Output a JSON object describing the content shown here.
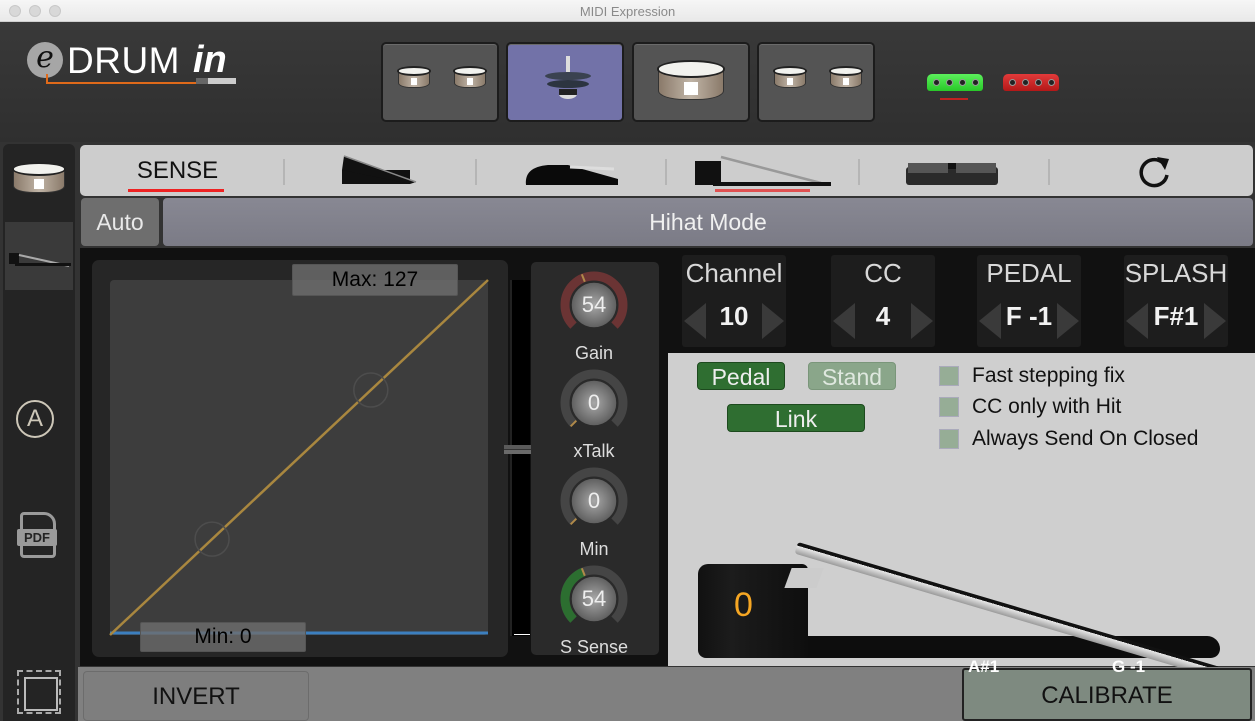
{
  "window": {
    "title": "MIDI Expression"
  },
  "logo": {
    "e": "e",
    "drum": "DRUM",
    "in": "in"
  },
  "header": {
    "pads": [
      {
        "name": "toms-left",
        "icon": "double-drum-icon",
        "active": false
      },
      {
        "name": "hihat",
        "icon": "hihat-cymbal-icon",
        "active": true
      },
      {
        "name": "snare",
        "icon": "snare-drum-icon",
        "active": false
      },
      {
        "name": "toms-right",
        "icon": "double-drum-icon",
        "active": false
      }
    ],
    "connectors": [
      {
        "name": "green-connector",
        "color": "#3ad43a",
        "selected": true
      },
      {
        "name": "red-connector",
        "color": "#cc2222",
        "selected": false
      }
    ]
  },
  "sidebar": {
    "items": [
      {
        "name": "drum-pad",
        "icon": "drum-icon"
      },
      {
        "name": "hihat-pedal",
        "icon": "hihat-pedal-icon",
        "selected": true
      },
      {
        "name": "auto",
        "icon": "circle-a-icon",
        "label": "A"
      },
      {
        "name": "pdf",
        "icon": "pdf-icon",
        "label": "PDF"
      },
      {
        "name": "hardware",
        "icon": "chip-icon"
      }
    ]
  },
  "tabs": {
    "sense_label": "SENSE",
    "items": [
      {
        "name": "sense",
        "selected": true
      },
      {
        "name": "expression-pedal",
        "icon": "expression-pedal-icon"
      },
      {
        "name": "sustain-pedal",
        "icon": "sustain-pedal-icon"
      },
      {
        "name": "hihat-pedal",
        "icon": "hihat-pedal-icon",
        "selected": true
      },
      {
        "name": "footswitch",
        "icon": "footswitch-icon"
      },
      {
        "name": "reset",
        "icon": "refresh-icon"
      }
    ],
    "accent": "#e02424"
  },
  "mode": {
    "auto_label": "Auto",
    "mode_label": "Hihat Mode"
  },
  "curve": {
    "max_label": "Max: 127",
    "min_label": "Min: 0",
    "max": 127,
    "min": 0,
    "control_points": [
      [
        0.27,
        0.27
      ],
      [
        0.69,
        0.69
      ]
    ],
    "level": 0,
    "curve_color": "#a9873f",
    "level_color": "#3c7fbf"
  },
  "knobs": [
    {
      "label": "Gain",
      "value": 54,
      "fraction": 0.42,
      "arc_color": "#6b3434",
      "active_color": "#6b3434"
    },
    {
      "label": "xTalk",
      "value": 0,
      "fraction": 0.0,
      "arc_color": "#454545",
      "active_color": "#454545"
    },
    {
      "label": "Min",
      "value": 0,
      "fraction": 0.0,
      "arc_color": "#454545",
      "active_color": "#454545"
    },
    {
      "label": "S Sense",
      "value": 54,
      "fraction": 0.42,
      "arc_color": "#454545",
      "active_color": "#2c6e30"
    }
  ],
  "spinners": [
    {
      "title": "Channel",
      "value": "10"
    },
    {
      "title": "CC",
      "value": "4"
    },
    {
      "title": "PEDAL",
      "value": "F -1"
    },
    {
      "title": "SPLASH",
      "value": "F#1"
    }
  ],
  "options": {
    "pedal_label": "Pedal",
    "stand_label": "Stand",
    "link_label": "Link",
    "pedal_on": true,
    "stand_on": false,
    "link_on": true,
    "checkboxes": [
      {
        "label": "Fast stepping fix",
        "checked": false
      },
      {
        "label": "CC only with Hit",
        "checked": false
      },
      {
        "label": "Always Send On Closed",
        "checked": false
      }
    ]
  },
  "pedal": {
    "value": "0",
    "open_note": "A#1",
    "closed_note": "G -1"
  },
  "bottom": {
    "invert_label": "INVERT",
    "calibrate_label": "CALIBRATE"
  }
}
